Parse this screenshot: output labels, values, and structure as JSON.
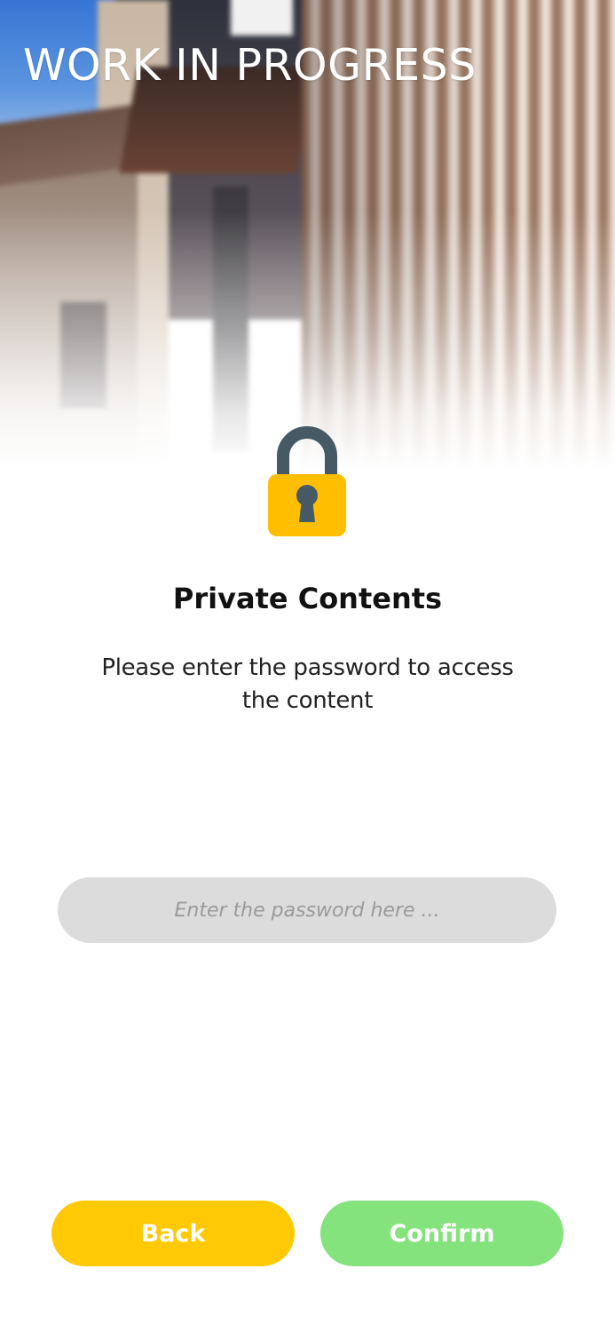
{
  "header": {
    "title": "WORK IN PROGRESS"
  },
  "lock": {
    "icon": "padlock-icon",
    "body_color": "#ffbf00",
    "shackle_color": "#455a64"
  },
  "content": {
    "heading": "Private Contents",
    "description": "Please enter the password to access the content"
  },
  "password": {
    "value": "",
    "placeholder": "Enter the password here ..."
  },
  "actions": {
    "back_label": "Back",
    "confirm_label": "Confirm",
    "back_color": "#ffca05",
    "confirm_color": "#85e37e"
  }
}
